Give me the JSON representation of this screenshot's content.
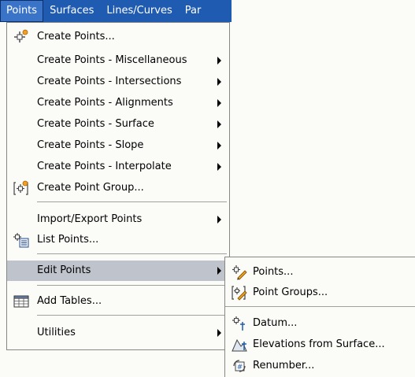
{
  "menubar": {
    "items": [
      {
        "label": "Points"
      },
      {
        "label": "Surfaces"
      },
      {
        "label": "Lines/Curves"
      },
      {
        "label": "Par"
      }
    ]
  },
  "points_menu": {
    "create_points": "Create Points...",
    "create_misc": "Create Points - Miscellaneous",
    "create_intersections": "Create Points - Intersections",
    "create_alignments": "Create Points - Alignments",
    "create_surface": "Create Points - Surface",
    "create_slope": "Create Points - Slope",
    "create_interpolate": "Create Points - Interpolate",
    "create_point_group": "Create Point Group...",
    "import_export": "Import/Export Points",
    "list_points": "List Points...",
    "edit_points": "Edit Points",
    "add_tables": "Add Tables...",
    "utilities": "Utilities"
  },
  "edit_points_submenu": {
    "points": "Points...",
    "point_groups": "Point Groups...",
    "datum": "Datum...",
    "elevations_from_surface": "Elevations from Surface...",
    "renumber": "Renumber..."
  },
  "icons": {
    "create_points": "create-point-icon",
    "create_point_group": "point-group-icon",
    "list_points": "list-points-icon",
    "add_tables": "table-icon",
    "edit_point": "edit-point-icon",
    "edit_point_groups": "edit-point-groups-icon",
    "datum": "datum-icon",
    "elevations": "elevation-icon",
    "renumber": "renumber-icon"
  },
  "colors": {
    "menubar_bg": "#1f5bb0",
    "menu_bg": "#fbfbf8",
    "highlight": "#bfc3cc"
  }
}
